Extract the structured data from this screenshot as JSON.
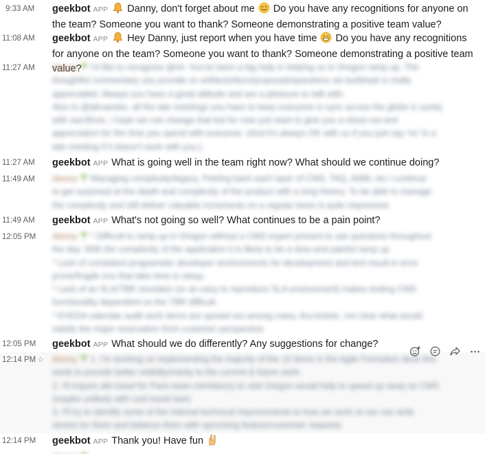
{
  "messages": [
    {
      "time": "9:33 AM",
      "author": "geekbot",
      "badge": "APP",
      "text_a": "Danny, don't forget about me",
      "text_b": "Do you have any recognitions for anyone on the team?  Someone you want to thank?  Someone demonstrating a positive team value?"
    },
    {
      "time": "11:08 AM",
      "author": "geekbot",
      "badge": "APP",
      "text_a": "Hey Danny, just report when you have time",
      "text_b": "Do you have any recognitions for anyone on the team?  Someone you want to thank?  Someone demonstrating a positive team value?"
    },
    {
      "time": "11:27 AM",
      "author_blur": "danny",
      "lines": [
        "I'd like to recognize @ml. You've been a big help in helping us in Oregon ramp up. The",
        "thoughtful commentary you provide on artifacts/docs/proposals/questions we build/ask is really",
        "appreciated. Always you have a great attitude and are a pleasure to talk with.",
        "Also to @alexandre, all the late meetings you have to keep everyone in sync across the globe is surely",
        "with sacrifices. I hope we can change that but for now just want to give you a shout out and",
        "appreciation for the time you spend with everyone. (And it's always OK with us if you just say 'no' to a",
        "late meeting if it doesn't work with you.)"
      ]
    },
    {
      "time": "11:27 AM",
      "author": "geekbot",
      "badge": "APP",
      "text": "What is going well in the team right now?  What should we continue doing?"
    },
    {
      "time": "11:49 AM",
      "author_blur": "danny",
      "lines": [
        "Managing complexity/legacy. Peeling back each layer of CMS, TAQ, AMM, etc I continue",
        "to get surprised at the depth and complexity of the product with a long history. To be able to manage",
        "the complexity and still deliver valuable increments on a regular basis is quite impressive."
      ]
    },
    {
      "time": "11:49 AM",
      "author": "geekbot",
      "badge": "APP",
      "text": "What's not going so well?  What continues to be a pain point?"
    },
    {
      "time": "12:05 PM",
      "author_blur": "danny",
      "lines": [
        "* Difficult to ramp up in Oregon without a CMS expert present to ask questions throughout",
        "the day. With the complexity of the application it is likely to be a slow and painful ramp up",
        "* Lack of consistent programatic developer environments for development and test result in error",
        "prone/fragile env that take time to setup.",
        "* Lack of an SLA/TBR simulator (or an easy to reproduce SLA environment) makes testing CMS",
        "functionality dependent on the TBR difficult.",
        "* EVEDA calendar audit work items are spread out among many Jira tickets, not clear what would",
        "satisfy the major reservation from customer perspective."
      ]
    },
    {
      "time": "12:05 PM",
      "author": "geekbot",
      "badge": "APP",
      "text": "What should we do differently?  Any suggestions for change?"
    },
    {
      "time": "12:14 PM",
      "author_blur": "danny",
      "lines": [
        "1. I'm working on implementing the majority of the 10 items in the Agile Formation deck this",
        "week to provide better visibility/clarity to the current & future work.",
        "2. I'll inquire abt travel for Paris team member(s) to visit Oregon would help to speed up ramp on CMS",
        "(maybe unlikely with cost travel ban)",
        "3. I'll try to identify some of the internal technical improvements to how we work so we can write",
        "stories for them and balance them with upcoming feature/customer requests"
      ]
    },
    {
      "time": "12:14 PM",
      "author": "geekbot",
      "badge": "APP",
      "text": "Thank you! Have fun"
    },
    {
      "time": "",
      "author_blur": "danny",
      "lines": [
        ""
      ]
    }
  ],
  "icons": {
    "bell": "bell-icon",
    "winking": "winking-face-icon",
    "sweat_smile": "grinning-face-with-sweat-icon",
    "rock_on": "sign-of-the-horns-icon"
  },
  "actions": [
    "add-reaction-icon",
    "reply-in-thread-icon",
    "share-message-icon",
    "more-actions-icon"
  ],
  "colors": {
    "text": "#1d1c1d",
    "muted": "#616061",
    "highlight": "#f8f8f8"
  }
}
